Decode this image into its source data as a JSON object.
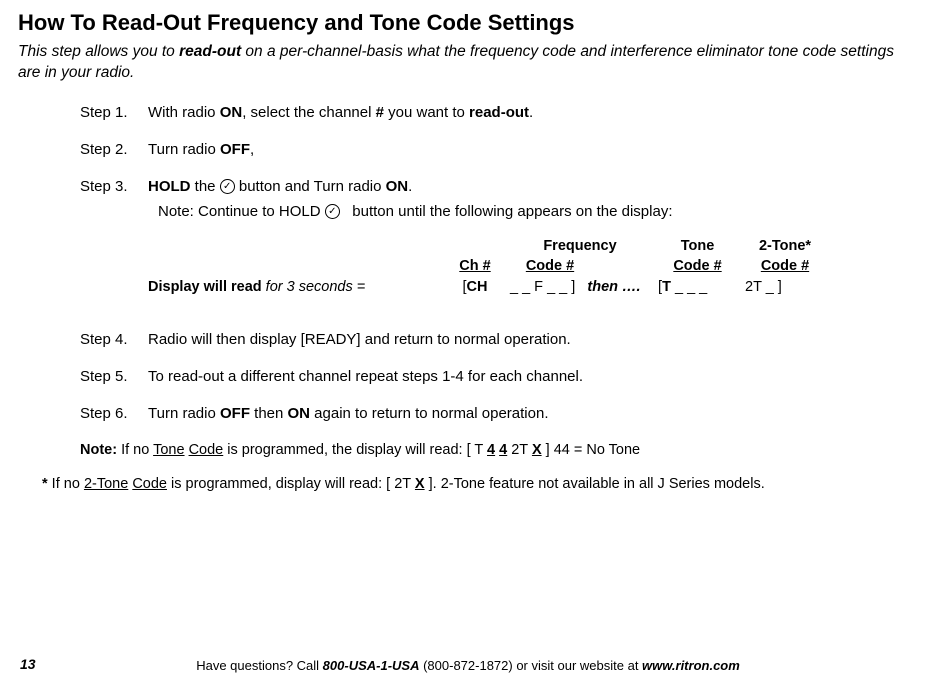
{
  "title": "How To Read-Out Frequency and Tone Code Settings",
  "subtitle": {
    "prefix": "This step allows you to ",
    "bold": "read-out",
    "suffix": " on a per-channel-basis what the frequency code and interference eliminator tone code settings are in your radio."
  },
  "steps": {
    "s1": {
      "label": "Step 1.",
      "p1": "With radio ",
      "on": "ON",
      "p2": ", select the channel ",
      "hash": "#",
      "p3": " you want to ",
      "readout": "read-out",
      "p4": "."
    },
    "s2": {
      "label": "Step 2.",
      "p1": "Turn radio ",
      "off": "OFF",
      "p2": ","
    },
    "s3": {
      "label": "Step 3.",
      "hold": "HOLD",
      "p1": " the ",
      "p2": " button and Turn radio ",
      "on": "ON",
      "p3": ".",
      "note_p1": "Note: Continue to HOLD ",
      "note_p2": " button until the following appears on the display:"
    },
    "s4": {
      "label": "Step 4.",
      "text": "Radio will then display [READY] and return to normal operation."
    },
    "s5": {
      "label": "Step 5.",
      "text": "To read-out a different channel repeat steps 1-4 for each channel."
    },
    "s6": {
      "label": "Step 6.",
      "p1": "Turn radio ",
      "off": "OFF",
      "p2": " then ",
      "on": "ON",
      "p3": " again to return to normal operation."
    }
  },
  "display_table": {
    "h_freq": "Frequency",
    "h_tone": "Tone",
    "h_2tone": "2-Tone*",
    "h_ch": "Ch #",
    "h_code1": "Code #",
    "h_code2": "Code #",
    "h_code3": "Code #",
    "lead_bold": "Display will read",
    "lead_italic": " for 3 seconds = ",
    "v_ch": "CH",
    "v_ch_rest": "  _  _ F _  _ ]",
    "then": "then ….",
    "v_tone": "T",
    "v_tone_rest": " _ _ _",
    "v_2t": "2T _ ]"
  },
  "note": {
    "bold": "Note:",
    "p1": " If no ",
    "u1": "Tone",
    "u2": "Code",
    "p2": " is programmed, the display will read: [ T ",
    "u3": "4",
    "u4": "4",
    "p3": "  2T ",
    "u5": "X",
    "p4": " ] 44 = No Tone"
  },
  "star_note": {
    "star": "*",
    "p1": "  If no ",
    "u1": "2-Tone",
    "u2": "Code",
    "p2": " is programmed, display will read:  [ 2T ",
    "u3": "X",
    "p3": "  ].  2-Tone feature not available in all J Series models."
  },
  "footer": {
    "p1": "Have questions? Call ",
    "phone_bold": "800-USA-1-USA",
    "p2": " (800-872-1872) or visit our website at ",
    "url_bold": "www.ritron.com"
  },
  "page_num": "13",
  "check_glyph": "✓"
}
